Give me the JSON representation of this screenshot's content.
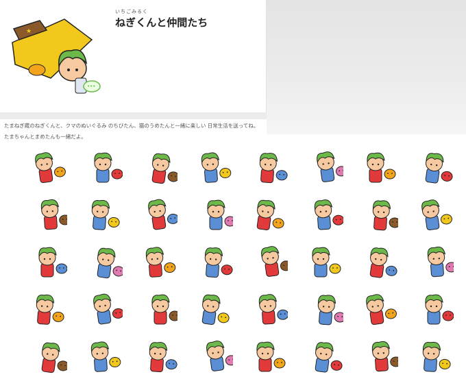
{
  "header": {
    "title": "ねぎくんと仲間たち",
    "author_reading": "いちごみるく"
  },
  "description": {
    "line1": "たまねぎ蔵のねぎくんと、クマのぬいぐるみ のちびたん、猫のうめたんと一緒に楽しい 日常生活を送ってね。",
    "line2": "たまちゃんとまめたんも一緒だよ。"
  },
  "sticker_count": 40,
  "colors": {
    "leaf_green": "#6cb94a",
    "skin": "#f6c9a0",
    "cat_orange": "#f2a51c",
    "book_brown": "#8b5a2b",
    "banner_yellow": "#f2c81c",
    "heart_red": "#e23a3a"
  }
}
